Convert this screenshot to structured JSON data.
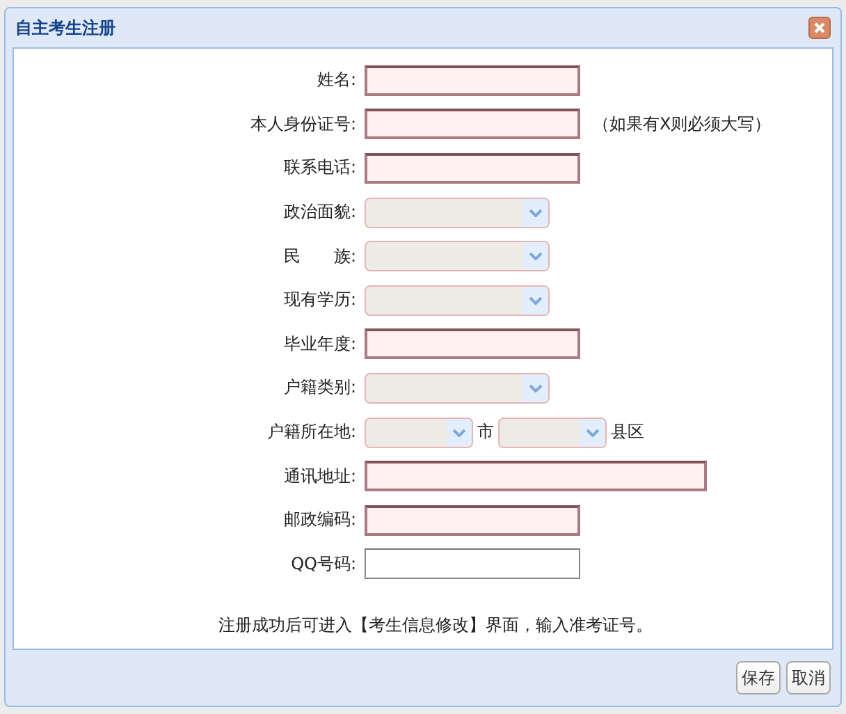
{
  "window": {
    "title": "自主考生注册"
  },
  "fields": [
    {
      "label": "姓名:",
      "kind": "text",
      "required": true
    },
    {
      "label": "本人身份证号:",
      "kind": "text",
      "required": true,
      "note": "（如果有X则必须大写）"
    },
    {
      "label": "联系电话:",
      "kind": "text",
      "required": true
    },
    {
      "label": "政治面貌:",
      "kind": "select",
      "disabled": true
    },
    {
      "label": "民　　族:",
      "kind": "select",
      "disabled": true
    },
    {
      "label": "现有学历:",
      "kind": "select",
      "disabled": true
    },
    {
      "label": "毕业年度:",
      "kind": "text",
      "required": true
    },
    {
      "label": "户籍类别:",
      "kind": "select",
      "disabled": true
    },
    {
      "label": "户籍所在地:",
      "kind": "region",
      "parts": [
        {
          "suffix": "市",
          "disabled": true
        },
        {
          "suffix": "县区",
          "disabled": true
        }
      ]
    },
    {
      "label": "通讯地址:",
      "kind": "longtext",
      "required": true
    },
    {
      "label": "邮政编码:",
      "kind": "text",
      "required": true
    },
    {
      "label": "QQ号码:",
      "kind": "text",
      "required": false
    }
  ],
  "notice": "注册成功后可进入【考生信息修改】界面，输入准考证号。",
  "buttons": [
    {
      "label": "保存"
    },
    {
      "label": "取消"
    }
  ]
}
